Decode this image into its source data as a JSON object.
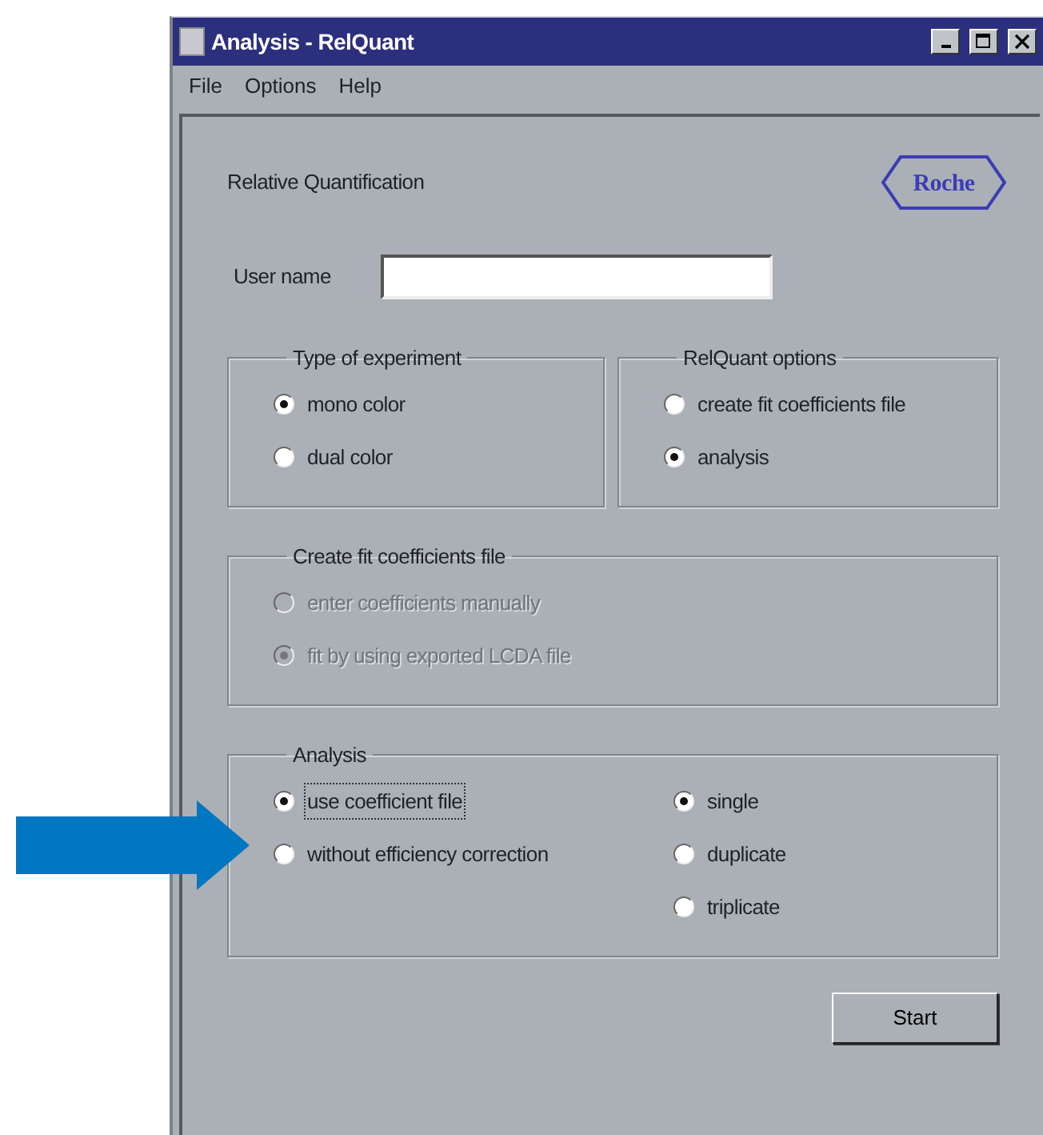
{
  "window": {
    "title": "Analysis - RelQuant"
  },
  "menu": [
    {
      "label": "File"
    },
    {
      "label": "Options"
    },
    {
      "label": "Help"
    }
  ],
  "heading": "Relative Quantification",
  "logo": {
    "text": "Roche"
  },
  "user_name": {
    "label": "User name"
  },
  "groups": [
    {
      "title": "Type of experiment",
      "disabled": false,
      "columns": [
        [
          {
            "label": "mono color",
            "selected": true,
            "focused": false
          },
          {
            "label": "dual color",
            "selected": false,
            "focused": false
          }
        ]
      ]
    },
    {
      "title": "RelQuant options",
      "disabled": false,
      "columns": [
        [
          {
            "label": "create fit coefficients file",
            "selected": false,
            "focused": false
          },
          {
            "label": "analysis",
            "selected": true,
            "focused": false
          }
        ]
      ]
    },
    {
      "title": "Create fit coefficients file",
      "disabled": true,
      "columns": [
        [
          {
            "label": "enter coefficients manually",
            "selected": false,
            "focused": false
          },
          {
            "label": "fit by using exported LCDA file",
            "selected": true,
            "focused": false
          }
        ]
      ]
    },
    {
      "title": "Analysis",
      "disabled": false,
      "columns": [
        [
          {
            "label": "use coefficient file",
            "selected": true,
            "focused": true
          },
          {
            "label": "without efficiency correction",
            "selected": false,
            "focused": false
          }
        ],
        [
          {
            "label": "single",
            "selected": true,
            "focused": false
          },
          {
            "label": "duplicate",
            "selected": false,
            "focused": false
          },
          {
            "label": "triplicate",
            "selected": false,
            "focused": false
          }
        ]
      ]
    }
  ],
  "start_button": {
    "label": "Start"
  },
  "callout_arrow": {
    "color": "#0077c0"
  }
}
